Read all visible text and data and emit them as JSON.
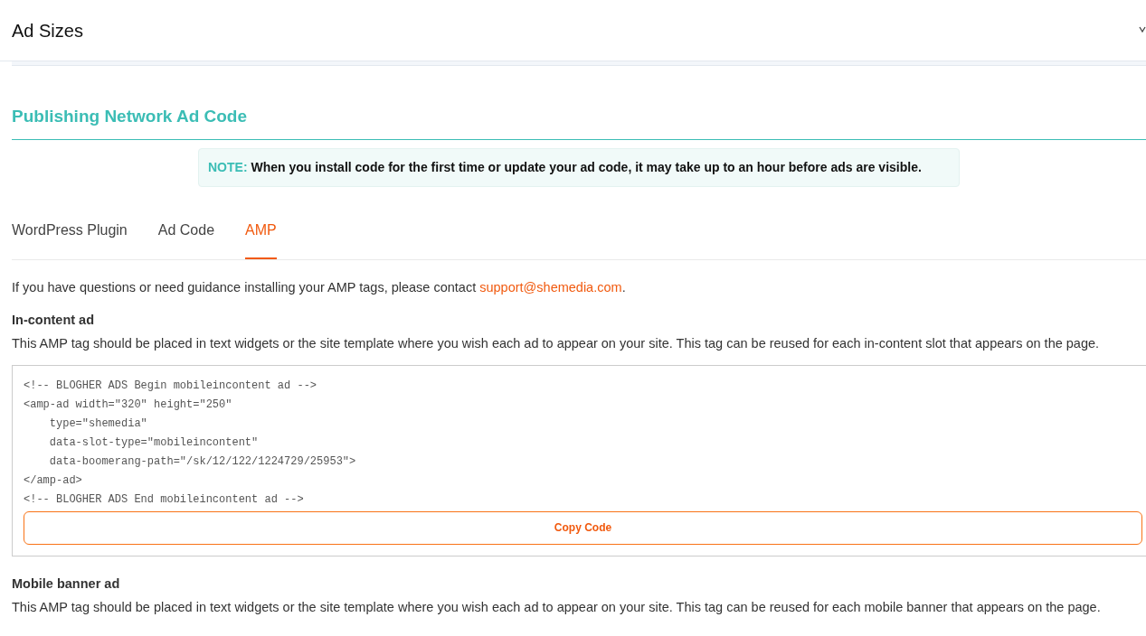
{
  "accordion": {
    "title": "Ad Sizes",
    "expanded": false
  },
  "section": {
    "title": "Publishing Network Ad Code"
  },
  "note": {
    "text": "**NOTE:** When you install code for the first time or update your ad code, it may take up to an hour before ads are visible."
  },
  "tabs": [
    {
      "label": "WordPress Plugin",
      "selected": false
    },
    {
      "label": "Ad Code",
      "selected": false
    },
    {
      "label": "AMP",
      "selected": true
    }
  ],
  "intro": {
    "text": "If you have questions or need guidance installing your AMP tags, please contact ",
    "link": "support@shemedia.com",
    "end": "."
  },
  "ads": [
    {
      "title": "In-content ad",
      "description": "This AMP tag should be placed in text widgets or the site template where you wish each ad to appear on your site. This tag can be reused for each in-content slot that appears on the page.",
      "code": [
        "<!-- BLOGHER ADS Begin mobileincontent ad -->",
        "<amp-ad width=\"320\" height=\"250\"",
        "    type=\"shemedia\"",
        "    data-slot-type=\"mobileincontent\"",
        "    data-boomerang-path=\"/sk/12/122/1224729/25953\">",
        "</amp-ad>",
        "<!-- BLOGHER ADS End mobileincontent ad -->"
      ],
      "button": "Copy Code"
    },
    {
      "title": "Mobile banner ad",
      "description": "This AMP tag should be placed in text widgets or the site template where you wish each ad to appear on your site. This tag can be reused for each mobile banner that appears on the page."
    }
  ]
}
